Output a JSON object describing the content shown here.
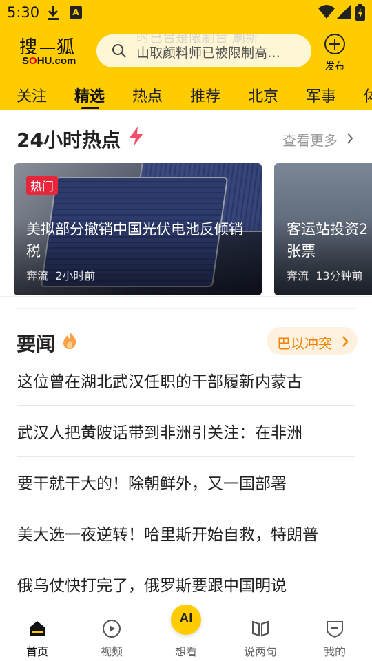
{
  "status_bar": {
    "time": "5:30"
  },
  "header": {
    "logo_cn": [
      "搜",
      "狐"
    ],
    "logo_en": [
      "S",
      "O",
      "HU.com"
    ],
    "search_placeholder": "山取颜料师已被限制高…",
    "search_ghost": "时已台是限制台 刷新",
    "publish_label": "发布"
  },
  "tabs": [
    {
      "label": "关注"
    },
    {
      "label": "精选"
    },
    {
      "label": "热点"
    },
    {
      "label": "推荐"
    },
    {
      "label": "北京"
    },
    {
      "label": "军事"
    },
    {
      "label": "体"
    }
  ],
  "hot24": {
    "title": "24小时热点",
    "see_more": "查看更多",
    "cards": [
      {
        "badge": "热门",
        "title": "美拟部分撤销中国光伏电池反倾销税",
        "source": "奔流",
        "time": "2小时前"
      },
      {
        "title": "客运站投资2",
        "title_line2": "张票",
        "source": "奔流",
        "time": "13分钟前"
      }
    ]
  },
  "news": {
    "title": "要闻",
    "topic_chip": "巴以冲突",
    "items": [
      "这位曾在湖北武汉任职的干部履新内蒙古",
      "武汉人把黄陂话带到非洲引关注：在非洲",
      "要干就干大的！除朝鲜外，又一国部署",
      "美大选一夜逆转！哈里斯开始自救，特朗普",
      "俄乌仗快打完了，俄罗斯要跟中国明说"
    ]
  },
  "bottom_nav": {
    "items": [
      {
        "label": "首页"
      },
      {
        "label": "视频"
      },
      {
        "label": "想看"
      },
      {
        "label": "说两句"
      },
      {
        "label": "我的"
      }
    ],
    "ai_label": "AI"
  },
  "colors": {
    "brand_yellow": "#FFCC00",
    "hot_red": "#E8263B",
    "topic_orange": "#F08300"
  }
}
